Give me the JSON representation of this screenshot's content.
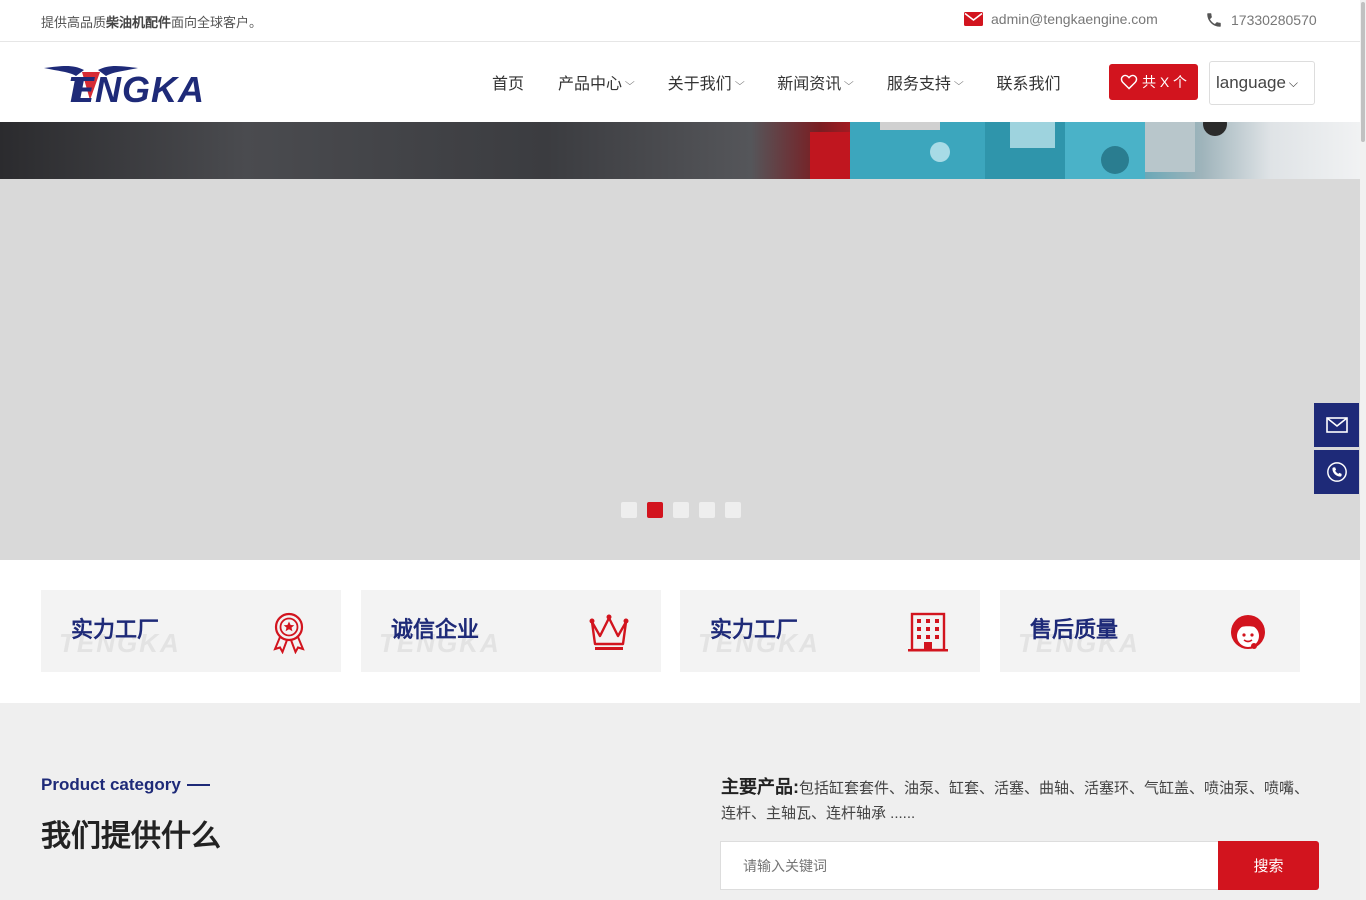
{
  "topbar": {
    "slogan_prefix": "提供高品质",
    "slogan_bold": "柴油机配件",
    "slogan_suffix": "面向全球客户。",
    "email": "admin@tengkaengine.com",
    "phone": "17330280570"
  },
  "header": {
    "logo_text": "TENGKA",
    "nav": [
      {
        "label": "首页",
        "has_dropdown": false
      },
      {
        "label": "产品中心",
        "has_dropdown": true
      },
      {
        "label": "关于我们",
        "has_dropdown": true
      },
      {
        "label": "新闻资讯",
        "has_dropdown": true
      },
      {
        "label": "服务支持",
        "has_dropdown": true
      },
      {
        "label": "联系我们",
        "has_dropdown": false
      }
    ],
    "favorites_label": "共 X 个",
    "language_label": "language"
  },
  "slider": {
    "slide_count": 5,
    "active_index": 1
  },
  "features": [
    {
      "title": "实力工厂",
      "icon": "award-ribbon-icon",
      "watermark": "TENGKA"
    },
    {
      "title": "诚信企业",
      "icon": "crown-icon",
      "watermark": "TENGKA"
    },
    {
      "title": "实力工厂",
      "icon": "building-icon",
      "watermark": "TENGKA"
    },
    {
      "title": "售后质量",
      "icon": "service-agent-icon",
      "watermark": "TENGKA"
    }
  ],
  "products": {
    "category_label": "Product category",
    "title": "我们提供什么",
    "main_label": "主要产品:",
    "main_text": "包括缸套套件、油泵、缸套、活塞、曲轴、活塞环、气缸盖、喷油泵、喷嘴、连杆、主轴瓦、连杆轴承 ......",
    "search_placeholder": "请输入关键词",
    "search_button": "搜索"
  },
  "colors": {
    "brand_red": "#d2141e",
    "brand_navy": "#1e2a78"
  }
}
